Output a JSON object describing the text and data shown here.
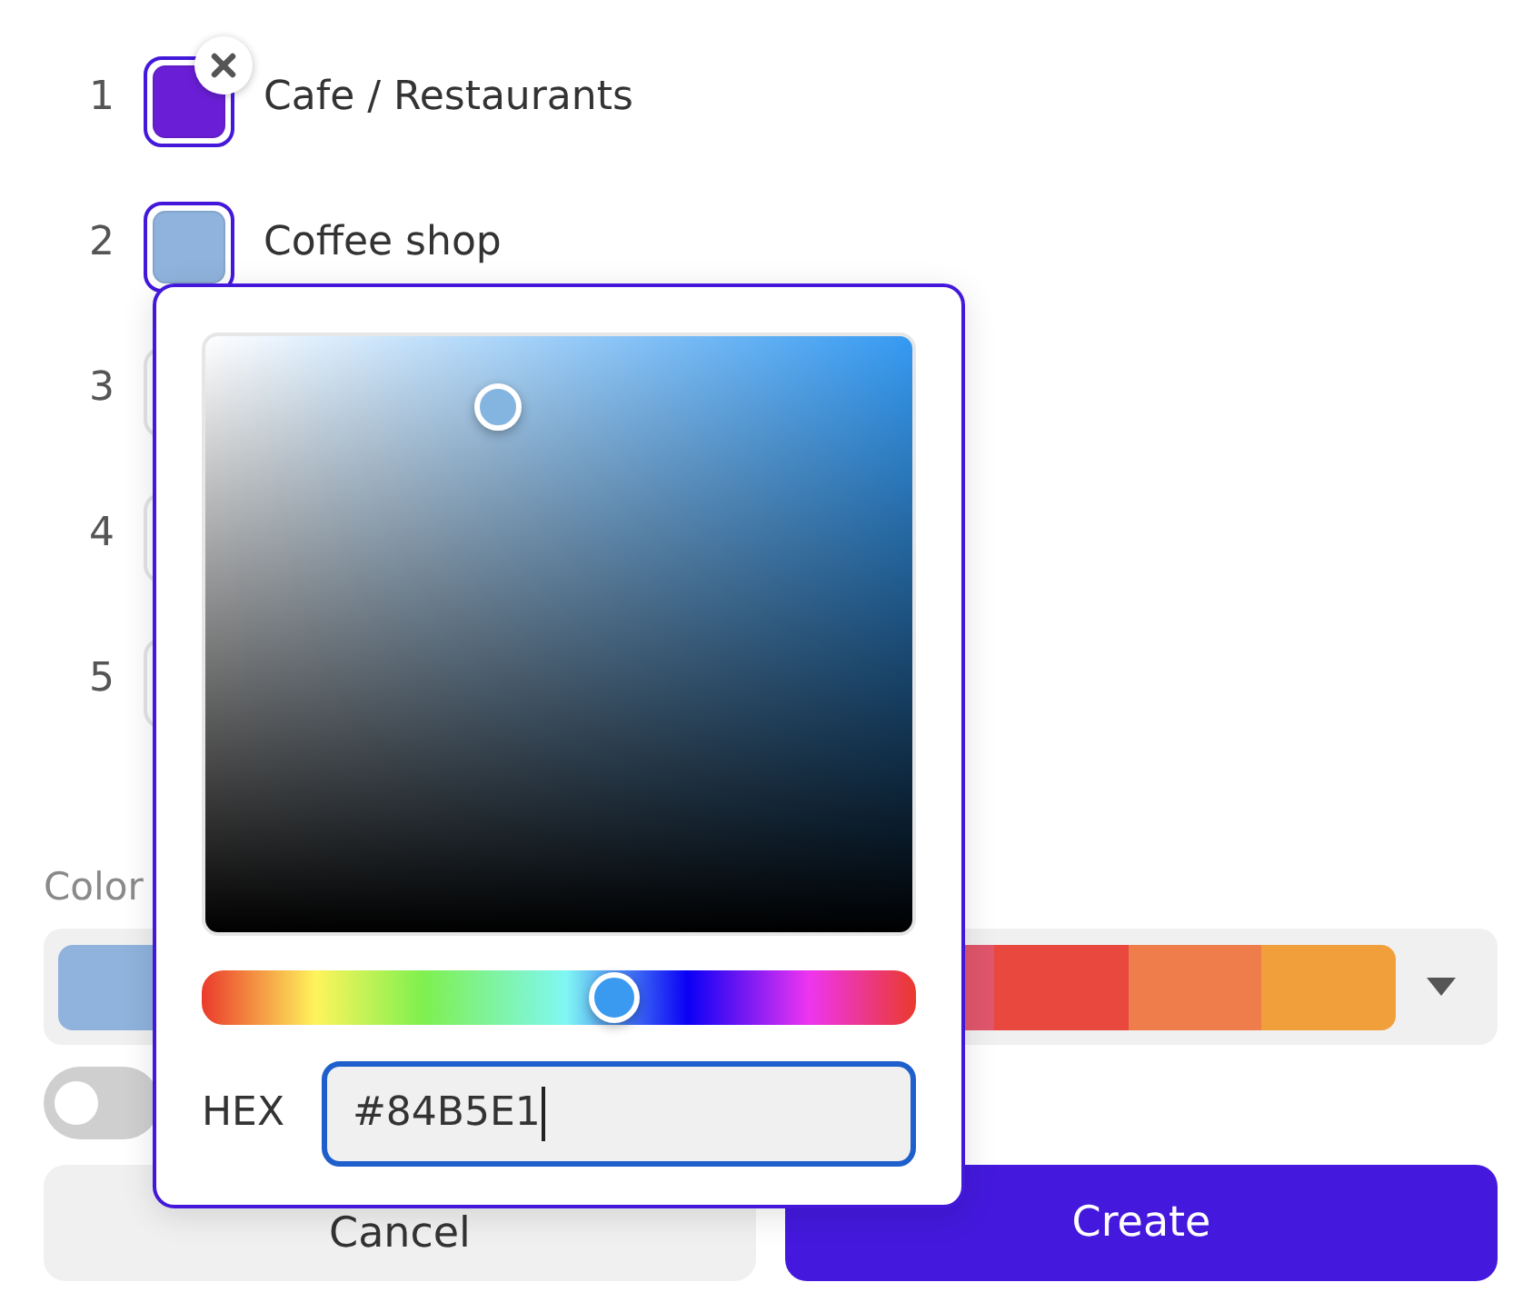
{
  "categories": [
    {
      "number": "1",
      "color": "#6a1fd6",
      "label": "Cafe / Restaurants",
      "selected": true,
      "remove_button": true
    },
    {
      "number": "2",
      "color": "#8fb3dd",
      "label": "Coffee shop",
      "selected": true,
      "remove_button": false
    },
    {
      "number": "3",
      "selected": false,
      "remove_button": false
    },
    {
      "number": "4",
      "selected": false,
      "remove_button": false
    },
    {
      "number": "5",
      "selected": false,
      "remove_button": false
    }
  ],
  "color_section": {
    "label": "Color",
    "palette": [
      {
        "color": "#8fb3dd"
      },
      {
        "color": "#e0566c"
      },
      {
        "color": "#e8483d"
      },
      {
        "color": "#ef7c4b"
      },
      {
        "color": "#f19f3a"
      }
    ]
  },
  "toggle": {
    "on": false
  },
  "buttons": [
    {
      "label": "Cancel",
      "kind": "secondary"
    },
    {
      "label": "Create",
      "kind": "primary"
    }
  ],
  "color_picker": {
    "hue": {
      "level": 0.578
    },
    "hex_label": "HEX",
    "hex_field": {
      "value": "#84B5E1",
      "focused": true
    }
  }
}
